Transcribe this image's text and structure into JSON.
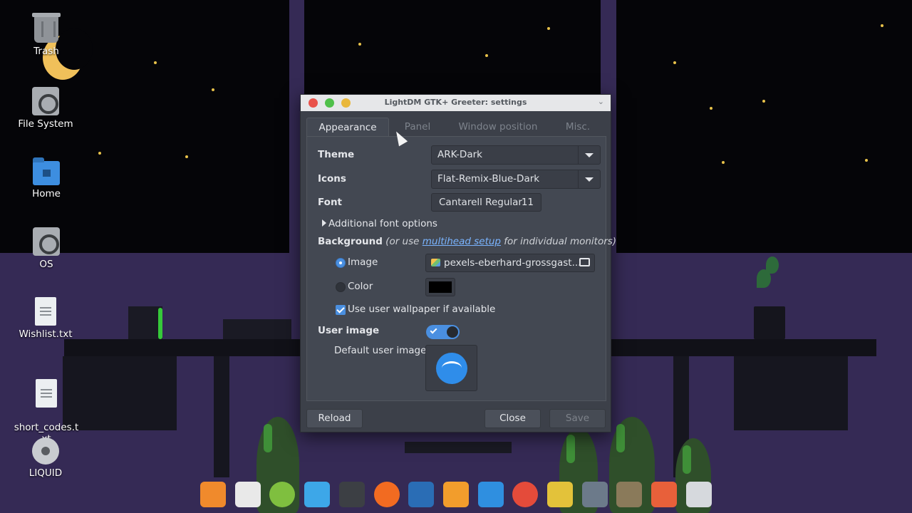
{
  "desktop": {
    "icons": [
      {
        "label": "Trash",
        "icon": "trash-icon"
      },
      {
        "label": "File System",
        "icon": "drive-icon"
      },
      {
        "label": "Home",
        "icon": "home-folder-icon"
      },
      {
        "label": "OS",
        "icon": "drive-icon"
      },
      {
        "label": "Wishlist.txt",
        "icon": "text-file-icon"
      },
      {
        "label": "short_codes.t\nxt",
        "icon": "text-file-icon"
      },
      {
        "label": "LIQUID",
        "icon": "disc-icon"
      }
    ]
  },
  "dialog": {
    "title": "LightDM GTK+ Greeter: settings",
    "tabs": [
      "Appearance",
      "Panel",
      "Window position",
      "Misc."
    ],
    "active_tab": "Appearance",
    "theme_label": "Theme",
    "theme_value": "ARK-Dark",
    "icons_label": "Icons",
    "icons_value": "Flat-Remix-Blue-Dark",
    "font_label": "Font",
    "font_value": "Cantarell Regular",
    "font_size": "11",
    "additional_font_options": "Additional font options",
    "background_label": "Background",
    "background_hint_prefix": "(or use ",
    "background_hint_link": "multihead setup",
    "background_hint_suffix": " for individual monitors)",
    "image_option": "Image",
    "image_file": "pexels-eberhard-grossgast...",
    "color_option": "Color",
    "background_color": "#000000",
    "use_user_wallpaper": "Use user wallpaper if available",
    "user_image_label": "User image",
    "default_user_image_label": "Default user image",
    "buttons": {
      "reload": "Reload",
      "close": "Close",
      "save": "Save"
    }
  },
  "dock": {
    "items": [
      {
        "name": "coffee-app-icon",
        "color": "#f08a2c"
      },
      {
        "name": "file-manager-icon",
        "color": "#e9e9e9"
      },
      {
        "name": "green-orb-icon",
        "color": "#7fbf3f"
      },
      {
        "name": "window-icon",
        "color": "#3da7e8"
      },
      {
        "name": "terminal-icon",
        "color": "#3c3f44"
      },
      {
        "name": "firefox-icon",
        "color": "#f26b21"
      },
      {
        "name": "timeshift-icon",
        "color": "#2a6db5"
      },
      {
        "name": "sublime-text-icon",
        "color": "#f29d2c"
      },
      {
        "name": "vscode-icon",
        "color": "#2f8fe0"
      },
      {
        "name": "chrome-icon",
        "color": "#e44b3a"
      },
      {
        "name": "bleachbit-icon",
        "color": "#e3c23a"
      },
      {
        "name": "mark-down-icon",
        "color": "#6c7a8a"
      },
      {
        "name": "gimp-icon",
        "color": "#8a7a5a"
      },
      {
        "name": "audio-recorder-icon",
        "color": "#e8603a"
      },
      {
        "name": "settings-panel-icon",
        "color": "#d6d9dd"
      }
    ]
  }
}
